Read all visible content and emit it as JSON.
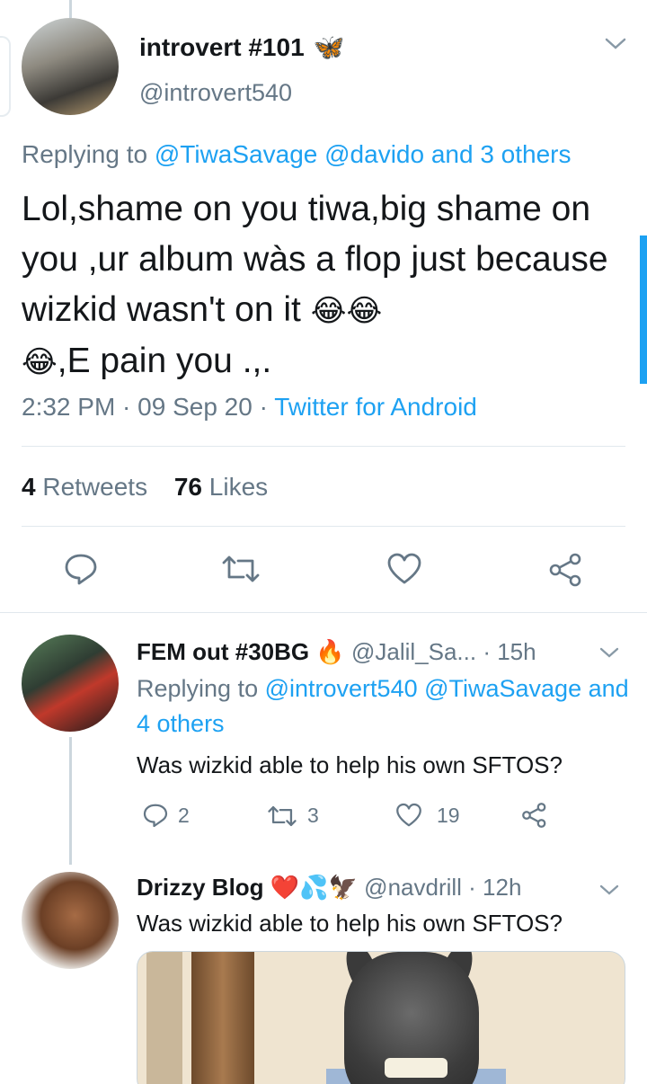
{
  "main_tweet": {
    "display_name": "introvert #101",
    "name_emoji": "🦋",
    "handle": "@introvert540",
    "replying_prefix": "Replying to",
    "replying_to": "@TiwaSavage @davido and 3 others",
    "text_part1": "Lol,shame on you tiwa,big shame on you ,ur album wàs a flop just because wizkid wasn't on it ",
    "emoji_laugh": "😂",
    "text_part2": ",E pain you .,.",
    "time": "2:32 PM · 09 Sep 20 · ",
    "source": "Twitter for Android",
    "retweets_count": "4",
    "retweets_label": "Retweets",
    "likes_count": "76",
    "likes_label": "Likes"
  },
  "replies": [
    {
      "display_name": "FEM out #30BG",
      "name_emoji": "🔥",
      "handle": "@Jalil_Sa...",
      "time": "· 15h",
      "replying_prefix": "Replying to",
      "replying_to": "@introvert540 @TiwaSavage and 4 others",
      "text": "Was wizkid able to help his own SFTOS?",
      "reply_count": "2",
      "retweet_count": "3",
      "like_count": "19"
    },
    {
      "display_name": "Drizzy Blog",
      "name_emoji": "❤️💦🦅",
      "handle": "@navdrill",
      "time": "· 12h",
      "text": "Was wizkid able to help his own SFTOS?"
    }
  ],
  "colors": {
    "accent": "#1da1f2",
    "secondary_text": "#657786",
    "primary_text": "#14171a",
    "divider": "#e1e8ed"
  },
  "icons": [
    "reply-icon",
    "retweet-icon",
    "like-icon",
    "share-icon",
    "chevron-down-icon"
  ]
}
